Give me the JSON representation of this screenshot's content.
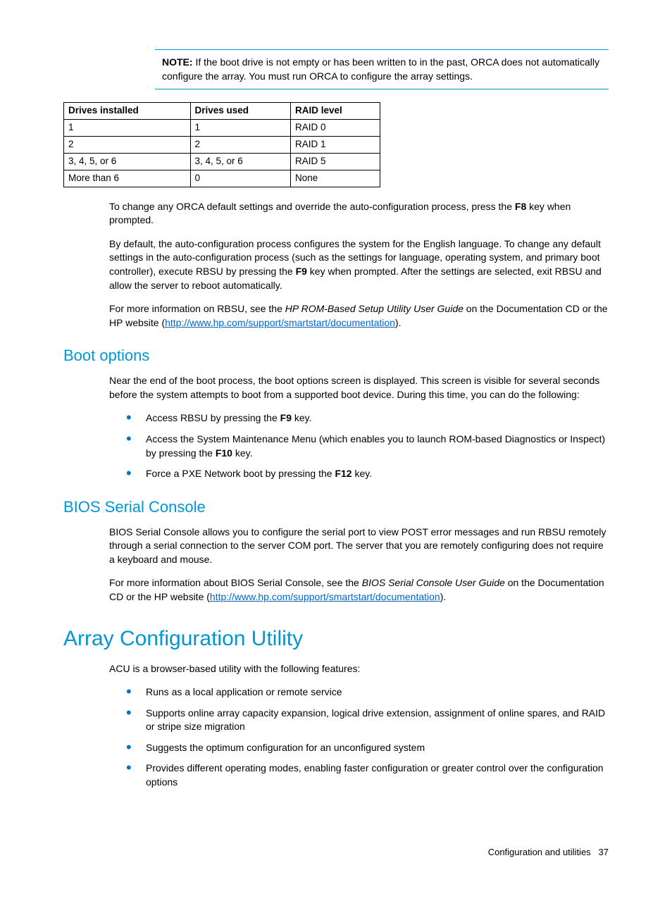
{
  "note": {
    "label": "NOTE:",
    "text": " If the boot drive is not empty or has been written to in the past, ORCA does not automatically configure the array. You must run ORCA to configure the array settings."
  },
  "table": {
    "headers": [
      "Drives installed",
      "Drives used",
      "RAID level"
    ],
    "rows": [
      [
        "1",
        "1",
        "RAID 0"
      ],
      [
        "2",
        "2",
        "RAID 1"
      ],
      [
        "3, 4, 5, or 6",
        "3, 4, 5, or 6",
        "RAID 5"
      ],
      [
        "More than 6",
        "0",
        "None"
      ]
    ]
  },
  "body": {
    "p1a": "To change any ORCA default settings and override the auto-configuration process, press the ",
    "p1_key": "F8",
    "p1b": " key when prompted.",
    "p2a": "By default, the auto-configuration process configures the system for the English language. To change any default settings in the auto-configuration process (such as the settings for language, operating system, and primary boot controller), execute RBSU by pressing the ",
    "p2_key": "F9",
    "p2b": " key when prompted. After the settings are selected, exit RBSU and allow the server to reboot automatically.",
    "p3a": "For more information on RBSU, see the ",
    "p3_italic": "HP ROM-Based Setup Utility User Guide",
    "p3b": " on the Documentation CD or the HP website (",
    "p3_link": "http://www.hp.com/support/smartstart/documentation",
    "p3c": ")."
  },
  "boot": {
    "heading": "Boot options",
    "intro": "Near the end of the boot process, the boot options screen is displayed. This screen is visible for several seconds before the system attempts to boot from a supported boot device. During this time, you can do the following:",
    "li1a": "Access RBSU by pressing the ",
    "li1_key": "F9",
    "li1b": " key.",
    "li2a": "Access the System Maintenance Menu (which enables you to launch ROM-based Diagnostics or Inspect) by pressing the ",
    "li2_key": "F10",
    "li2b": " key.",
    "li3a": "Force a PXE Network boot by pressing the ",
    "li3_key": "F12",
    "li3b": " key."
  },
  "bios": {
    "heading": "BIOS Serial Console",
    "p1": "BIOS Serial Console allows you to configure the serial port to view POST error messages and run RBSU remotely through a serial connection to the server COM port. The server that you are remotely configuring does not require a keyboard and mouse.",
    "p2a": "For more information about BIOS Serial Console, see the ",
    "p2_italic": "BIOS Serial Console User Guide",
    "p2b": " on the Documentation CD or the HP website (",
    "p2_link": "http://www.hp.com/support/smartstart/documentation",
    "p2c": ")."
  },
  "acu": {
    "heading": "Array Configuration Utility",
    "intro": "ACU is a browser-based utility with the following features:",
    "items": [
      "Runs as a local application or remote service",
      "Supports online array capacity expansion, logical drive extension, assignment of online spares, and RAID or stripe size migration",
      "Suggests the optimum configuration for an unconfigured system",
      "Provides different operating modes, enabling faster configuration or greater control over the configuration options"
    ]
  },
  "footer": {
    "section": "Configuration and utilities",
    "page": "37"
  }
}
